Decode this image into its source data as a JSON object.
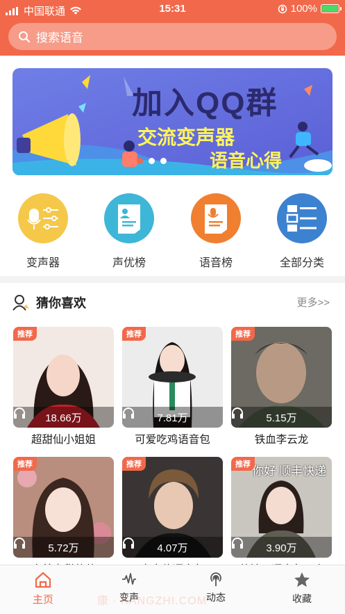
{
  "status_bar": {
    "carrier": "中国联通",
    "time": "15:31",
    "battery_percent": "100%"
  },
  "search": {
    "placeholder": "搜索语音"
  },
  "banner": {
    "line1": "加入QQ群",
    "line2": "交流变声器",
    "line3": "语音心得",
    "slides": 3,
    "active_slide": 0
  },
  "categories": [
    {
      "label": "变声器",
      "icon": "microphone-sliders-icon",
      "color": "#f5c84a"
    },
    {
      "label": "声优榜",
      "icon": "profile-document-icon",
      "color": "#3eb6d8"
    },
    {
      "label": "语音榜",
      "icon": "mic-document-icon",
      "color": "#f07f30"
    },
    {
      "label": "全部分类",
      "icon": "list-grid-icon",
      "color": "#3d82d0"
    }
  ],
  "section": {
    "title": "猜你喜欢",
    "more": "更多>>",
    "icon": "user-guess-icon"
  },
  "cards": [
    {
      "tag": "推荐",
      "plays": "18.66万",
      "title": "超甜仙小姐姐",
      "caption": ""
    },
    {
      "tag": "推荐",
      "plays": "7.81万",
      "title": "可爱吃鸡语音包",
      "caption": ""
    },
    {
      "tag": "推荐",
      "plays": "5.15万",
      "title": "铁血李云龙",
      "caption": ""
    },
    {
      "tag": "推荐",
      "plays": "5.72万",
      "title": "人美声甜萌萌",
      "caption": ""
    },
    {
      "tag": "推荐",
      "plays": "4.07万",
      "title": "卢本伟语音包",
      "caption": ""
    },
    {
      "tag": "推荐",
      "plays": "3.90万",
      "title": "萌妹子语音包 · 吃",
      "caption": "你好 顺丰快递"
    }
  ],
  "tabbar": [
    {
      "label": "主页",
      "icon": "home-icon",
      "active": true
    },
    {
      "label": "变声",
      "icon": "waveform-icon",
      "active": false
    },
    {
      "label": "动态",
      "icon": "broadcast-icon",
      "active": false
    },
    {
      "label": "收藏",
      "icon": "star-icon",
      "active": false
    }
  ],
  "watermark": "康 · KANGZHI.COM",
  "colors": {
    "brand": "#f2684a",
    "tab_active": "#f2684a"
  }
}
